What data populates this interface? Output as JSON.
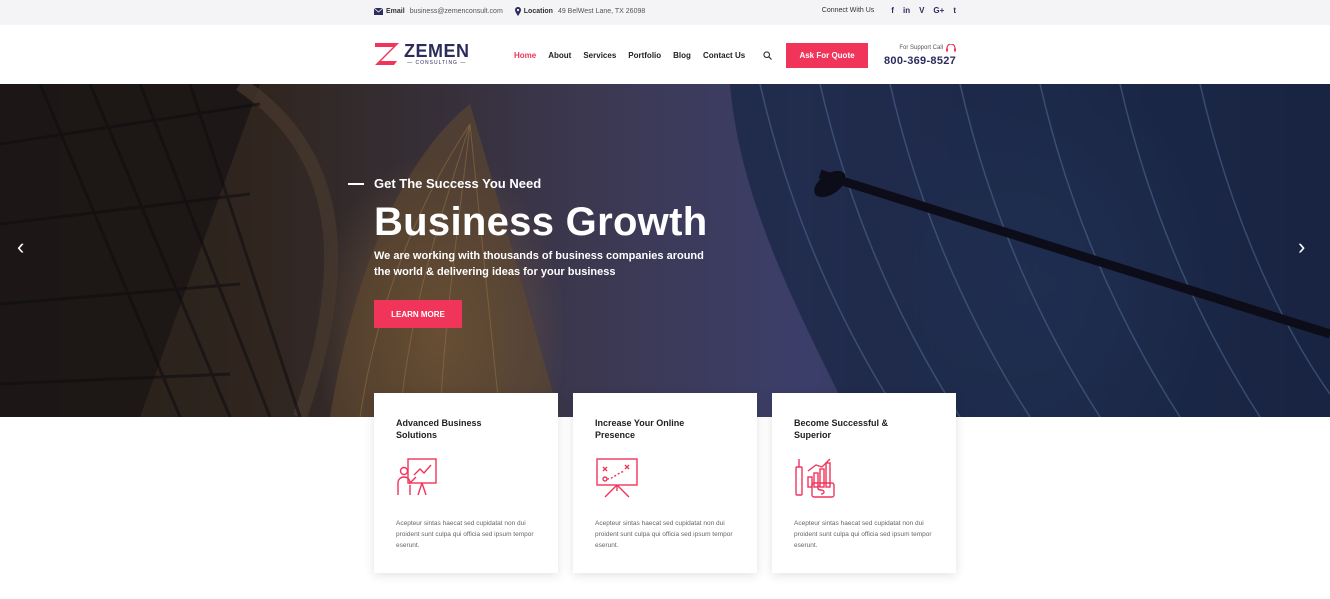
{
  "topbar": {
    "email_label": "Email",
    "email_value": "business@zemenconsult.com",
    "location_label": "Location",
    "location_value": "49 BelWest Lane, TX 26098",
    "connect_label": "Connect With Us",
    "social": [
      "f",
      "in",
      "V",
      "G+",
      "t"
    ]
  },
  "header": {
    "logo_name": "ZEMEN",
    "logo_sub": "CONSULTING",
    "nav": [
      "Home",
      "About",
      "Services",
      "Portfolio",
      "Blog",
      "Contact Us"
    ],
    "active_nav": "Home",
    "quote_button": "Ask For Quote",
    "support_label": "For Support Call",
    "support_phone": "800-369-8527"
  },
  "hero": {
    "eyebrow": "Get The Success You Need",
    "title": "Business Growth",
    "description": "We are working with thousands of business companies around the world & delivering ideas for your business",
    "button": "LEARN MORE",
    "prev_arrow": "‹",
    "next_arrow": "›"
  },
  "cards": [
    {
      "title": "Advanced Business Solutions",
      "icon": "presentation-person-icon",
      "text": "Acepteur sintas haecat sed cupidatat non dui proident sunt culpa qui officia sed ipsum tempor eserunt."
    },
    {
      "title": "Increase Your Online Presence",
      "icon": "strategy-board-icon",
      "text": "Acepteur sintas haecat sed cupidatat non dui proident sunt culpa qui officia sed ipsum tempor eserunt."
    },
    {
      "title": "Become Successful & Superior",
      "icon": "growth-chart-icon",
      "text": "Acepteur sintas haecat sed cupidatat non dui proident sunt culpa qui officia sed ipsum tempor eserunt."
    }
  ],
  "colors": {
    "accent": "#f0345a",
    "brand": "#2c2c5c"
  }
}
